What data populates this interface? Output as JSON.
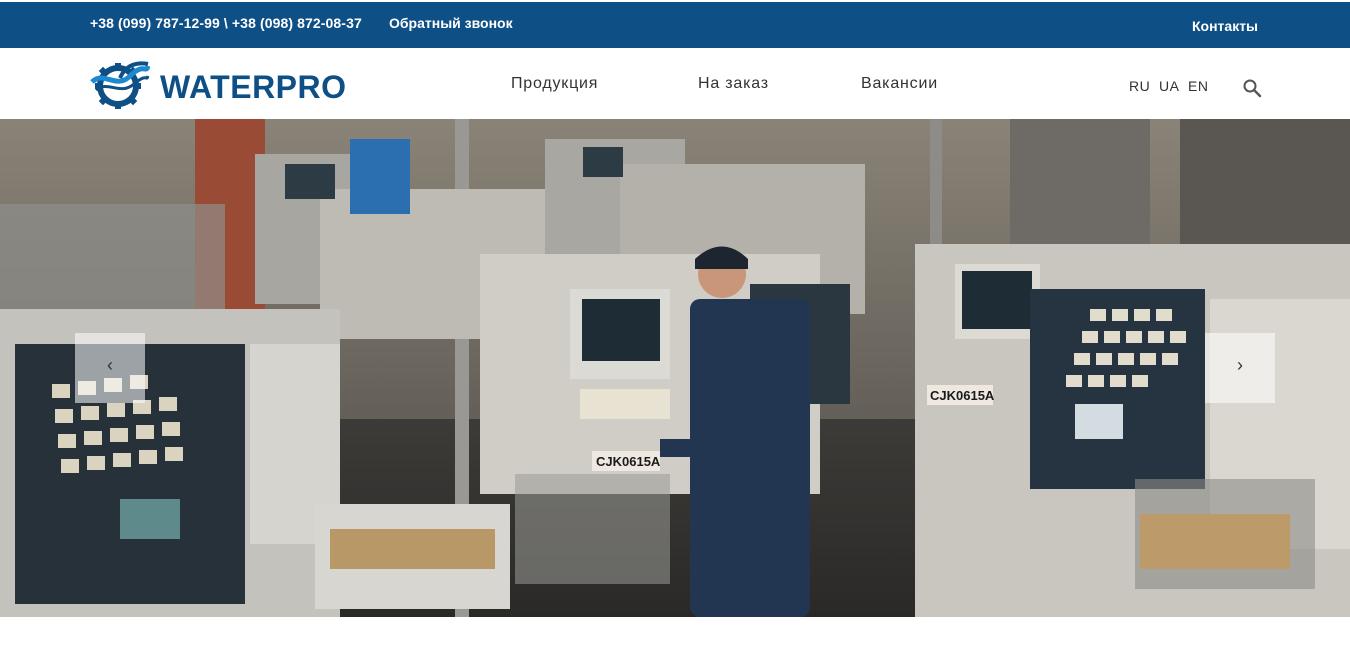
{
  "topbar": {
    "phones": "+38 (099) 787-12-99 \\ +38 (098) 872-08-37",
    "callback": "Обратный звонок",
    "contacts": "Контакты"
  },
  "header": {
    "logo_text": "WATERPRO",
    "nav": [
      "Продукция",
      "На заказ",
      "Вакансии"
    ],
    "languages": [
      "RU",
      "UA",
      "EN"
    ],
    "search_icon": "search-icon"
  },
  "slider": {
    "prev_label": "‹",
    "next_label": "›",
    "plate_1": "CJK0615A",
    "plate_2": "CJK0615A"
  },
  "colors": {
    "brand": "#0e4f86"
  }
}
